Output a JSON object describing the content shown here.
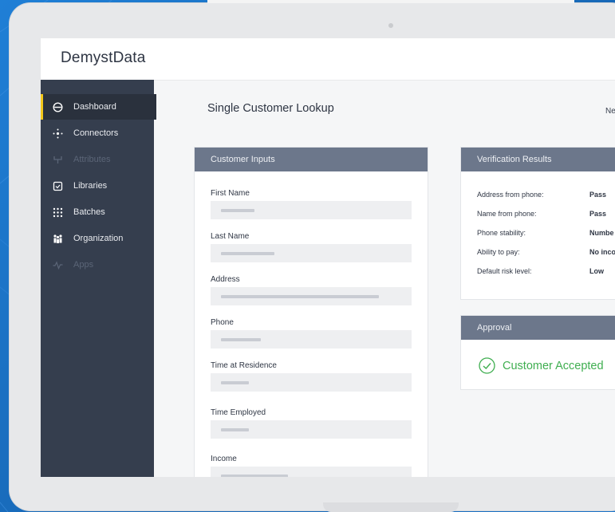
{
  "app": {
    "brand": "DemystData"
  },
  "sidebar": {
    "items": [
      {
        "label": "Dashboard",
        "icon": "gauge-icon",
        "active": true
      },
      {
        "label": "Connectors",
        "icon": "connectors-icon"
      },
      {
        "label": "Attributes",
        "icon": "attributes-icon",
        "dim": true
      },
      {
        "label": "Libraries",
        "icon": "library-icon"
      },
      {
        "label": "Batches",
        "icon": "grid-dots-icon"
      },
      {
        "label": "Organization",
        "icon": "people-icon"
      },
      {
        "label": "Apps",
        "icon": "pulse-icon",
        "dim": true
      }
    ]
  },
  "main": {
    "title": "Single Customer Lookup",
    "top_right": "Ne"
  },
  "inputs": {
    "header": "Customer Inputs",
    "fields": [
      {
        "label": "First Name"
      },
      {
        "label": "Last Name"
      },
      {
        "label": "Address"
      },
      {
        "label": "Phone"
      },
      {
        "label": "Time at Residence"
      },
      {
        "label": "Time Employed"
      },
      {
        "label": "Income"
      }
    ]
  },
  "verification": {
    "header": "Verification Results",
    "rows": [
      {
        "key": "Address from phone:",
        "value": "Pass"
      },
      {
        "key": "Name from phone:",
        "value": "Pass"
      },
      {
        "key": "Phone stability:",
        "value": "Numbe"
      },
      {
        "key": "Ability to pay:",
        "value": "No inco"
      },
      {
        "key": "Default risk level:",
        "value": "Low"
      }
    ]
  },
  "approval": {
    "header": "Approval",
    "status": "Customer Accepted",
    "status_color": "#3fae50"
  },
  "colors": {
    "accent": "#f2c71b",
    "sidebar": "#353e4e",
    "card_header": "#6c778b"
  }
}
